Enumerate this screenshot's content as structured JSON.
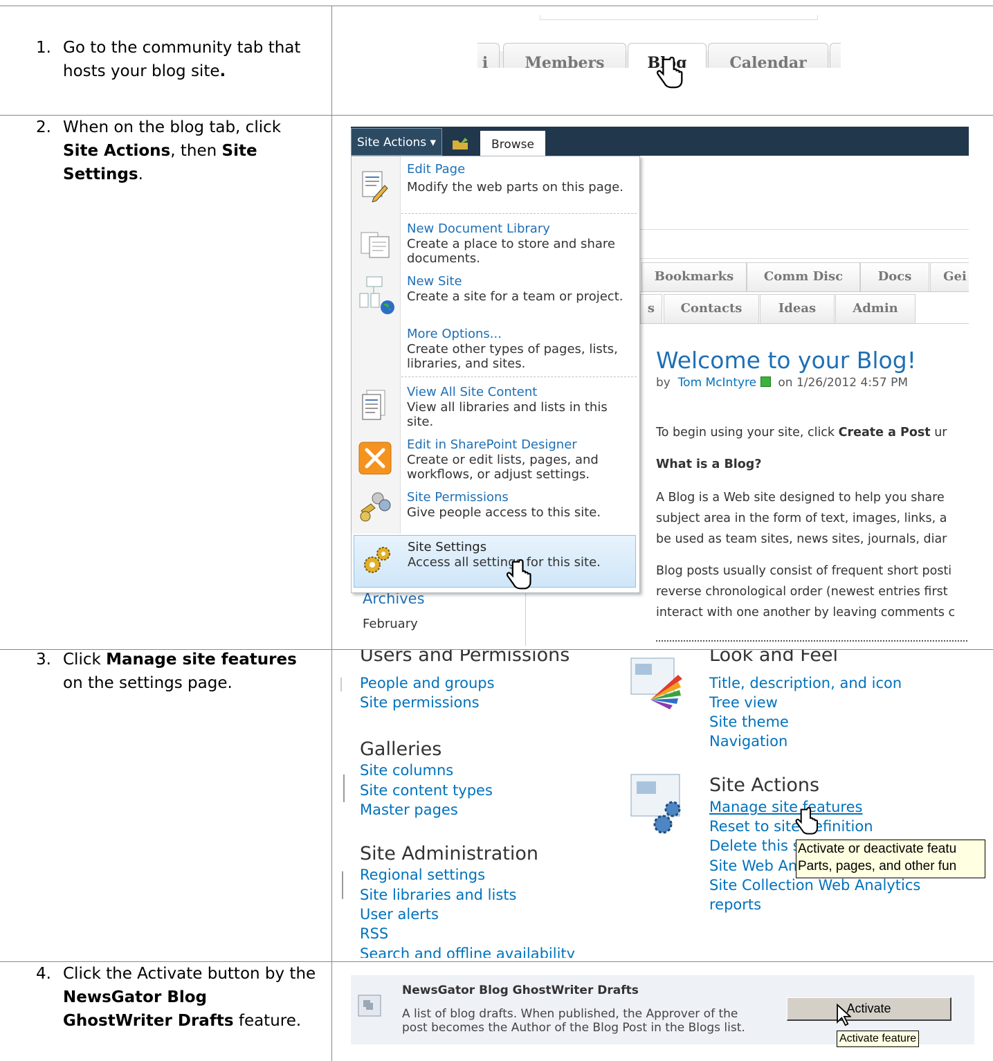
{
  "steps": [
    {
      "num": "1.",
      "pre": "Go to the community tab that hosts your blog site",
      "bold": "."
    },
    {
      "num": "2.",
      "pre": "When on the blog tab, click ",
      "b1": "Site Actions",
      "mid": ", then ",
      "b2": "Site Settings",
      "end": "."
    },
    {
      "num": "3.",
      "pre": "Click ",
      "b1": "Manage site features",
      "end": " on the settings page."
    },
    {
      "num": "4.",
      "pre": "Click the Activate button by the ",
      "b1": "NewsGator Blog GhostWriter Drafts",
      "end": " feature."
    }
  ],
  "tabs_top": [
    "i",
    "Members",
    "Blog",
    "Calendar"
  ],
  "sharepoint": {
    "site_actions": "Site Actions",
    "browse": "Browse",
    "menu": [
      {
        "title": "Edit Page",
        "desc": "Modify the web parts on this page."
      },
      {
        "title": "New Document Library",
        "desc": "Create a place to store and share documents."
      },
      {
        "title": "New Site",
        "desc": "Create a site for a team or project."
      },
      {
        "title": "More Options...",
        "desc": "Create other types of pages, lists, libraries, and sites."
      },
      {
        "title": "View All Site Content",
        "desc": "View all libraries and lists in this site."
      },
      {
        "title": "Edit in SharePoint Designer",
        "desc": "Create or edit lists, pages, and workflows, or adjust settings."
      },
      {
        "title": "Site Permissions",
        "desc": "Give people access to this site."
      },
      {
        "title": "Site Settings",
        "desc": "Access all settings for this site."
      }
    ],
    "tabs_row1": [
      "Bookmarks",
      "Comm Disc",
      "Docs",
      "Gei"
    ],
    "tabs_row2": [
      "s",
      "Contacts",
      "Ideas",
      "Admin"
    ],
    "welcome": "Welcome to your Blog!",
    "by": "by",
    "author": "Tom McIntyre",
    "date": "on 1/26/2012 4:57 PM",
    "begin_pre": "To begin using your site, click ",
    "begin_bold": "Create a Post",
    "begin_post": " ur",
    "what_is": "What is a Blog?",
    "para1": [
      "A Blog is a Web site designed to help you share",
      "subject area in the form of text, images, links, a",
      "be used as team sites, news sites, journals, diar"
    ],
    "para2": [
      "Blog posts usually consist of frequent short posti",
      "reverse chronological order (newest entries first",
      "interact with one another by leaving comments c"
    ],
    "archives": "Archives",
    "february": "February"
  },
  "settings": {
    "users_head": "Users and Permissions",
    "users_links": [
      "People and groups",
      "Site permissions"
    ],
    "galleries_head": "Galleries",
    "galleries_links": [
      "Site columns",
      "Site content types",
      "Master pages"
    ],
    "admin_head": "Site Administration",
    "admin_links": [
      "Regional settings",
      "Site libraries and lists",
      "User alerts",
      "RSS",
      "Search and offline availability"
    ],
    "look_head": "Look and Feel",
    "look_links": [
      "Title, description, and icon",
      "Tree view",
      "Site theme",
      "Navigation"
    ],
    "actions_head": "Site Actions",
    "actions_links": [
      "Manage site features",
      "Reset to site definition",
      "Delete this s",
      "Site Web An",
      "Site Collection Web Analytics",
      "reports"
    ],
    "tooltip": [
      "Activate or deactivate featu",
      "Parts, pages, and other fun"
    ]
  },
  "feature": {
    "title": "NewsGator Blog GhostWriter Drafts",
    "desc": [
      "A list of blog drafts. When published, the Approver of the",
      "post becomes the Author of the Blog Post in the Blogs list."
    ],
    "button": "Activate",
    "tooltip": "Activate feature"
  }
}
